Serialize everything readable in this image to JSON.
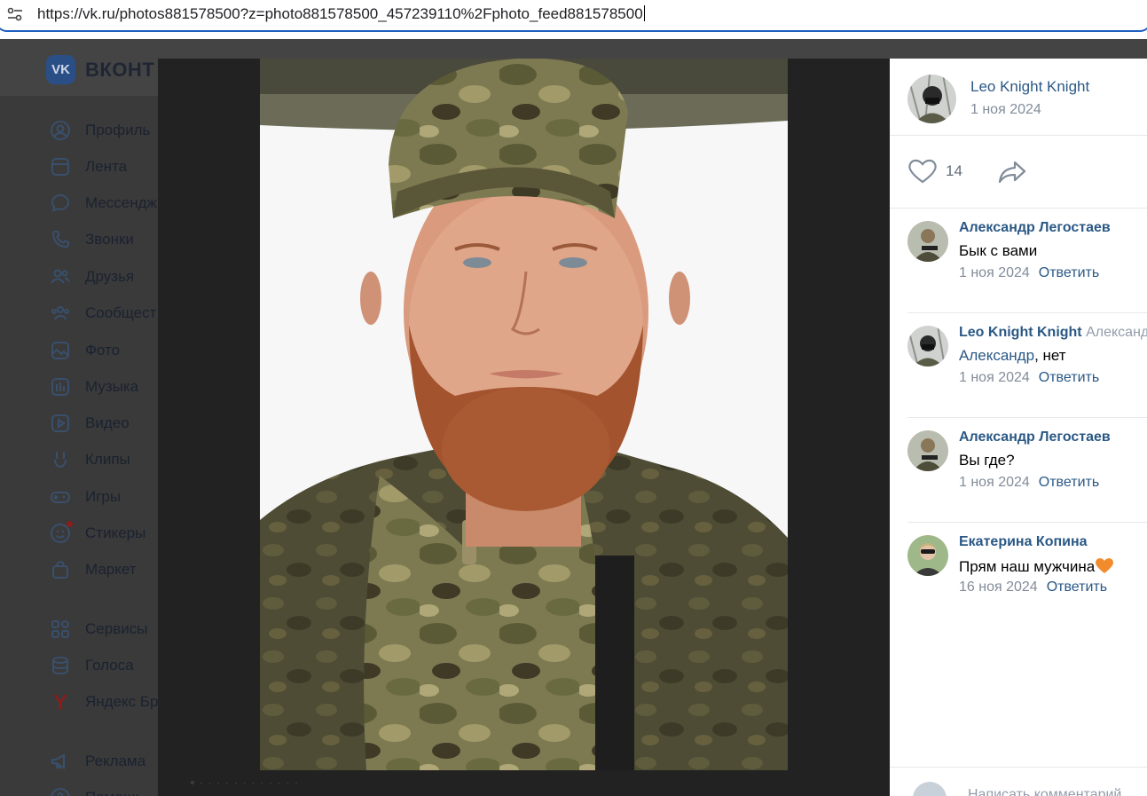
{
  "browser": {
    "url": "https://vk.ru/photos881578500?z=photo881578500_457239110%2Fphoto_feed881578500"
  },
  "vk": {
    "logo_text": "VK",
    "brand": "ВКОНТ",
    "nav": [
      {
        "label": "Профиль",
        "icon": "profile-icon"
      },
      {
        "label": "Лента",
        "icon": "feed-icon"
      },
      {
        "label": "Мессендж",
        "icon": "messenger-icon"
      },
      {
        "label": "Звонки",
        "icon": "phone-icon"
      },
      {
        "label": "Друзья",
        "icon": "friends-icon"
      },
      {
        "label": "Сообщест",
        "icon": "communities-icon"
      },
      {
        "label": "Фото",
        "icon": "photo-icon"
      },
      {
        "label": "Музыка",
        "icon": "music-icon"
      },
      {
        "label": "Видео",
        "icon": "video-icon"
      },
      {
        "label": "Клипы",
        "icon": "clips-icon"
      },
      {
        "label": "Игры",
        "icon": "games-icon"
      },
      {
        "label": "Стикеры",
        "icon": "stickers-icon"
      },
      {
        "label": "Маркет",
        "icon": "market-icon"
      },
      {
        "label": "Сервисы",
        "icon": "services-icon"
      },
      {
        "label": "Голоса",
        "icon": "votes-icon"
      },
      {
        "label": "Яндекс Бр",
        "icon": "yandex-icon"
      },
      {
        "label": "Реклама",
        "icon": "ads-icon"
      },
      {
        "label": "Помощь",
        "icon": "help-icon"
      }
    ]
  },
  "viewer": {
    "bottom_text": "• · · ·  · ·  ·  ·  ·  ·  ·  ·  ·"
  },
  "panel": {
    "author_name": "Leo Knight Knight",
    "date": "1 ноя 2024",
    "likes": "14",
    "comments": [
      {
        "name": "Александр Легостаев",
        "reply_to": "",
        "text_link": "",
        "text": "Бык с вами",
        "date": "1 ноя 2024",
        "reply": "Ответить"
      },
      {
        "name": "Leo Knight Knight",
        "reply_to": "Александ",
        "text_link": "Александр",
        "text": ", нет",
        "date": "1 ноя 2024",
        "reply": "Ответить"
      },
      {
        "name": "Александр Легостаев",
        "reply_to": "",
        "text_link": "",
        "text": "Вы где?",
        "date": "1 ноя 2024",
        "reply": "Ответить"
      },
      {
        "name": "Екатерина Копина",
        "reply_to": "",
        "text_link": "",
        "text": "Прям наш мужчина",
        "date": "16 ноя 2024",
        "reply": "Ответить"
      }
    ],
    "comment_placeholder": "Написать комментарий"
  },
  "colors": {
    "link": "#2a5885",
    "muted": "#818c99",
    "accent_blue": "#1f5fbf"
  }
}
